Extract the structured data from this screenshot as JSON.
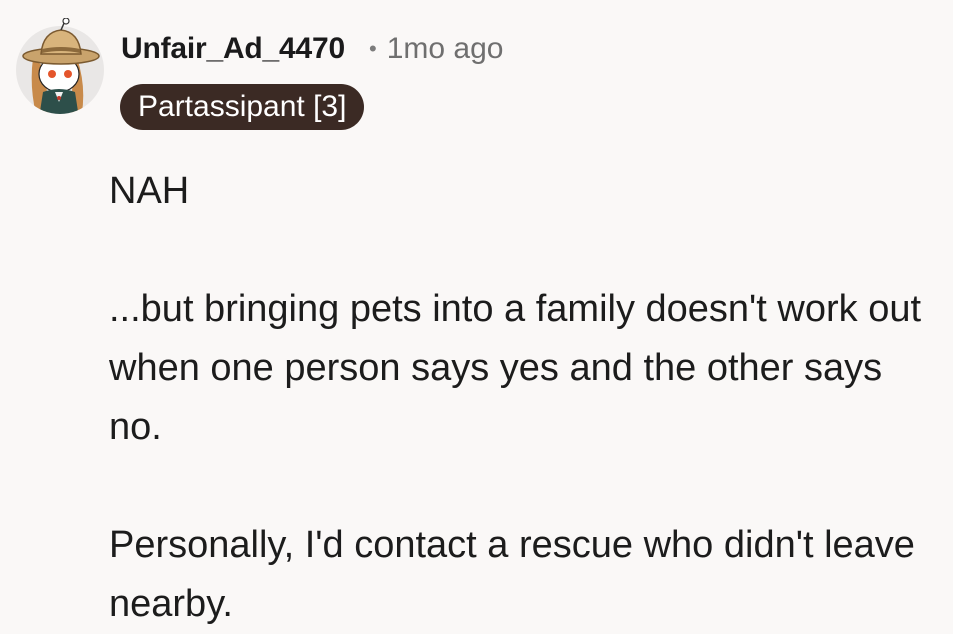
{
  "comment": {
    "author": "Unfair_Ad_4470",
    "separator": "•",
    "timestamp": "1mo ago",
    "flair": "Partassipant [3]",
    "avatar_icon": "snoo-avatar-cowboy-hat-icon",
    "paragraphs": [
      "NAH",
      "...but bringing pets into a family doesn't work out when one person says yes and the other says no.",
      "Personally, I'd contact a rescue who didn't leave nearby."
    ]
  },
  "colors": {
    "background": "#faf8f7",
    "flair_background": "#3b2a24",
    "flair_text": "#ffffff",
    "timestamp": "#6f6f6f"
  }
}
